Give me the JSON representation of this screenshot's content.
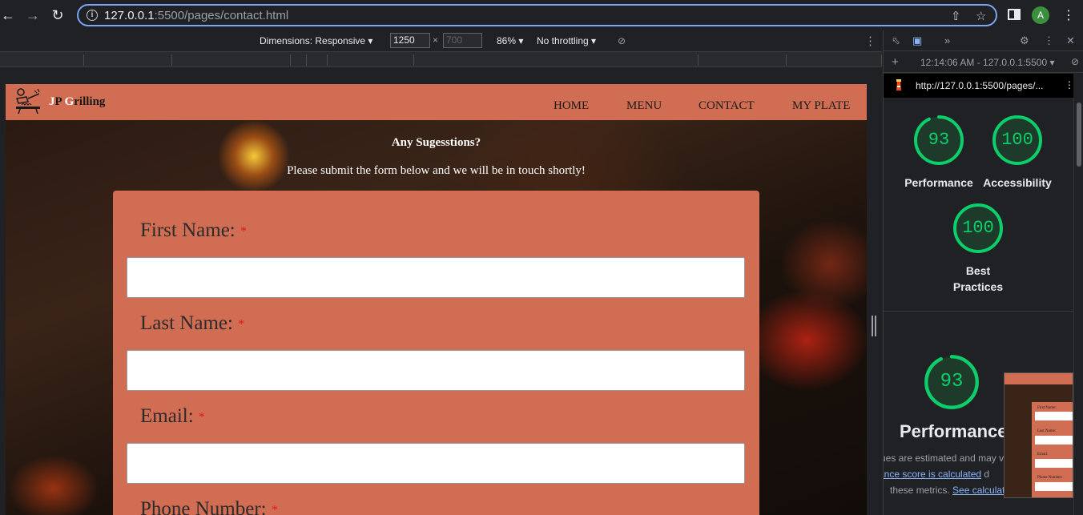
{
  "browser": {
    "url_host": "127.0.0.1",
    "url_rest": ":5500/pages/contact.html",
    "avatar_initial": "A"
  },
  "device_toolbar": {
    "dimensions_label": "Dimensions: Responsive ▾",
    "width_value": "1250",
    "times": "×",
    "height_placeholder": "700",
    "zoom": "86% ▾",
    "throttling": "No throttling ▾"
  },
  "site": {
    "logo_text_first": "J",
    "logo_text_p": "P ",
    "logo_text_g": "G",
    "logo_text_rest": "rilling",
    "nav": [
      "HOME",
      "MENU",
      "CONTACT",
      "MY PLATE"
    ],
    "hero_title": "Any Sugesstions?",
    "hero_sub": "Please submit the form below and we will be in touch shortly!",
    "form": {
      "fields": [
        {
          "label": "First Name:",
          "required": "*"
        },
        {
          "label": "Last Name:",
          "required": "*"
        },
        {
          "label": "Email:",
          "required": "*"
        },
        {
          "label": "Phone Number:",
          "required": "*"
        }
      ]
    },
    "colors": {
      "brand": "#d16d52"
    }
  },
  "devtools": {
    "session": "12:14:06 AM - 127.0.0.1:5500 ▾",
    "report_url": "http://127.0.0.1:5500/pages/...",
    "scores": [
      {
        "value": "93",
        "label": "Performance",
        "percent": 93
      },
      {
        "value": "100",
        "label": "Accessibility",
        "percent": 100
      },
      {
        "value": "100",
        "label": "Best Practices",
        "percent": 100
      }
    ],
    "best_line1": "Best",
    "best_line2": "Practices",
    "perf_score": "93",
    "perf_percent": 93,
    "perf_title": "Performance",
    "note_line1": "ues are estimated and may va",
    "note_line2_link": "mance score is calculated",
    "note_line2_rest": " d",
    "note_line3_text": "these metrics. ",
    "note_line3_link": "See calculato",
    "thumb_labels": [
      "First Name:",
      "Last Name:",
      "Email:",
      "Phone Number:"
    ],
    "good_color": "#0cce6b"
  }
}
